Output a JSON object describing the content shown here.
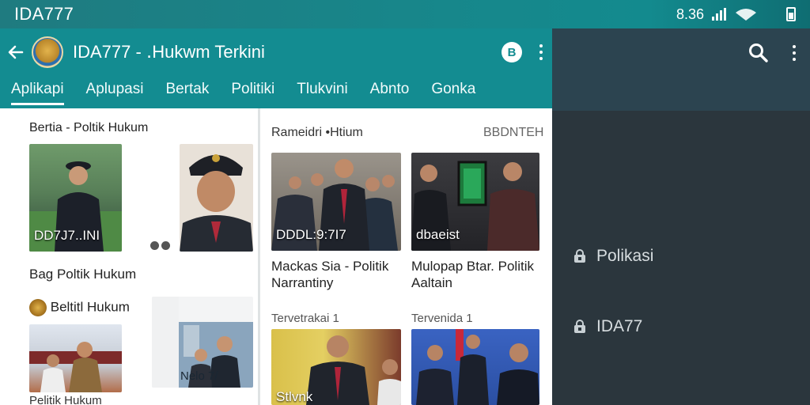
{
  "status_bar": {
    "app_name": "IDA777",
    "time": "8.36"
  },
  "app_bar": {
    "title": "IDA777 - ․Hukwm Terkini",
    "badge": "B"
  },
  "tabs": [
    "Aplikapi",
    "Aplupasi",
    "Bertak",
    "Politiki",
    "Tlukvini",
    "Abnto",
    "Gonka"
  ],
  "left_column": {
    "section_title": "Bertia - Poltik Hukum",
    "photo1_overlay": "DD7J7..INI",
    "section2_title": "Bag Poltik Hukum",
    "section3_title": "Beltitl Hukum",
    "photo5_overlay": "Nelo 7/",
    "bottom_caption": "Pelitik Hukum"
  },
  "right_column": {
    "heading": "Rameidri •Htium",
    "heading_right": "BBDNTEH",
    "card1": {
      "overlay": "DDDL:9:7I7",
      "caption_line1": "Mackas Sia - Politik",
      "caption_line2": "Narrantiny"
    },
    "card2": {
      "overlay": "dbaeist",
      "caption_line1": "Mulopap Btar. Politik",
      "caption_line2": "Aaltain"
    },
    "sub1": "Tervetrakai 1",
    "sub2": "Tervenida 1",
    "card3_overlay": "Stlvnk"
  },
  "drawer": {
    "items": [
      "Polikasi",
      "IDA77"
    ]
  }
}
